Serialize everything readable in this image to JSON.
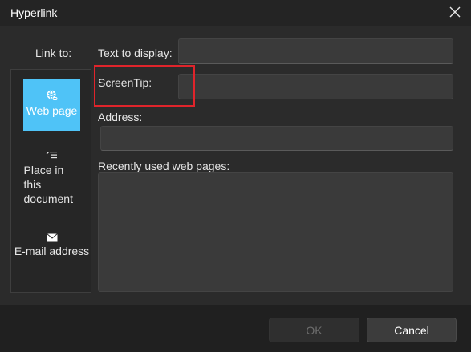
{
  "dialog": {
    "title": "Hyperlink",
    "close_icon": "close-icon"
  },
  "link_to": {
    "label": "Link to:",
    "options": [
      {
        "label": "Web page",
        "icon": "globe-link-icon",
        "selected": true
      },
      {
        "label": "Place in this document",
        "icon": "document-outline-icon",
        "selected": false
      },
      {
        "label": "E-mail address",
        "icon": "envelope-icon",
        "selected": false
      }
    ]
  },
  "fields": {
    "text_to_display": {
      "label": "Text to display:",
      "value": ""
    },
    "screentip": {
      "label": "ScreenTip:",
      "value": ""
    },
    "address": {
      "label": "Address:",
      "value": ""
    },
    "recent": {
      "label": "Recently used web pages:",
      "items": []
    }
  },
  "buttons": {
    "ok": {
      "label": "OK",
      "enabled": false
    },
    "cancel": {
      "label": "Cancel",
      "enabled": true
    }
  },
  "colors": {
    "selected_option": "#4fc3f7",
    "highlight": "#e0242b",
    "background": "#2b2b2b"
  }
}
